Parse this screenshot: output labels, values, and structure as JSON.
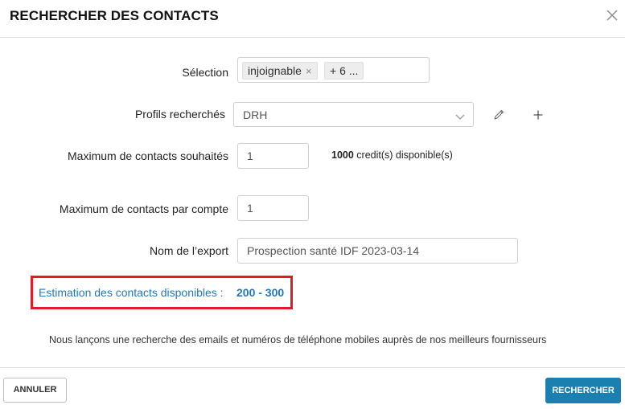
{
  "dialog": {
    "title": "RECHERCHER DES CONTACTS",
    "close_icon": "close-icon"
  },
  "form": {
    "selection": {
      "label": "Sélection",
      "tags": [
        "injoignable",
        "+ 6 ..."
      ],
      "remove_icon": "×"
    },
    "profiles": {
      "label": "Profils recherchés",
      "value": "DRH",
      "edit_icon": "pencil-icon",
      "add_icon": "+"
    },
    "max_contacts": {
      "label": "Maximum de contacts souhaités",
      "value": "1",
      "credits_count": "1000",
      "credits_text": " credit(s) disponible(s)"
    },
    "max_per_account": {
      "label": "Maximum de contacts par compte",
      "value": "1"
    },
    "export_name": {
      "label": "Nom de l’export",
      "value": "Prospection santé IDF 2023-03-14"
    }
  },
  "estimate": {
    "label": "Estimation des contacts disponibles :",
    "value": "200 - 300"
  },
  "note": "Nous lançons une recherche des emails et numéros de téléphone mobiles auprès de nos meilleurs fournisseurs",
  "footer": {
    "cancel_label": "ANNULER",
    "search_label": "RECHERCHER"
  },
  "colors": {
    "primary": "#1b7fb0",
    "link": "#1f79b8",
    "highlight_border": "#e01b24"
  }
}
